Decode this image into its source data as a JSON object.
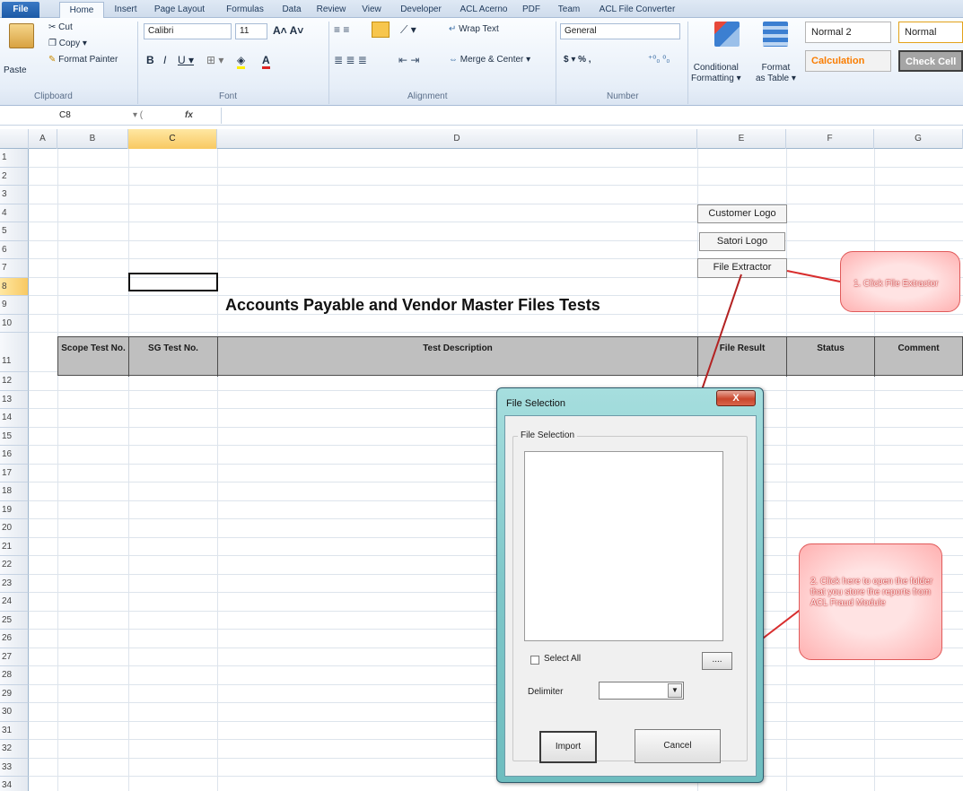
{
  "tabs": [
    "File",
    "Home",
    "Insert",
    "Page Layout",
    "Formulas",
    "Data",
    "Review",
    "View",
    "Developer",
    "ACL Acerno",
    "PDF",
    "Team",
    "ACL File Converter"
  ],
  "ribbon": {
    "clipboard": {
      "paste": "Paste",
      "cut": "Cut",
      "copy": "Copy ▾",
      "format_painter": "Format Painter",
      "label": "Clipboard"
    },
    "font": {
      "name": "Calibri",
      "size": "11",
      "label": "Font"
    },
    "alignment": {
      "wrap_text": "Wrap Text",
      "merge_center": "Merge & Center ▾",
      "label": "Alignment"
    },
    "number": {
      "format": "General",
      "currency": "$ ▾ % ,",
      "label": "Number"
    },
    "styles": {
      "conditional": "Conditional\nFormatting ▾",
      "format_table": "Format\nas Table ▾",
      "normal2": "Normal 2",
      "normal": "Normal",
      "calculation": "Calculation",
      "check_cell": "Check Cell"
    }
  },
  "formula_bar": {
    "name_box": "C8",
    "fx": "fx"
  },
  "columns": [
    "A",
    "B",
    "C",
    "D",
    "E",
    "F",
    "G"
  ],
  "rows": [
    "1",
    "2",
    "3",
    "4",
    "5",
    "6",
    "7",
    "8",
    "9",
    "10",
    "11",
    "12",
    "13",
    "14",
    "15",
    "16",
    "17",
    "18",
    "19",
    "20",
    "21",
    "22",
    "23",
    "24",
    "25",
    "26",
    "27",
    "28",
    "29",
    "30",
    "31",
    "32",
    "33",
    "34"
  ],
  "sheet": {
    "buttons": {
      "customer_logo": "Customer Logo",
      "satori_logo": "Satori Logo",
      "file_extractor": "File Extractor"
    },
    "title": "Accounts Payable and Vendor Master Files Tests",
    "table_headers": [
      "Scope Test No.",
      "SG Test No.",
      "Test Description",
      "File Result",
      "Status",
      "Comment"
    ]
  },
  "callouts": {
    "step1": "1. Click File Extractor",
    "step2": "2. Click here to open the folder that you store the  reports from ACL Fraud Module"
  },
  "dialog": {
    "title": "File Selection",
    "close": "X",
    "frame_label": "File Selection",
    "select_all": "Select All",
    "browse": "....",
    "delimiter_label": "Delimiter",
    "delimiter_value": "",
    "import": "Import",
    "cancel": "Cancel"
  },
  "colors": {
    "accent": "#1c5aa6",
    "selected_header": "#f8c962",
    "callout": "#e05a5a",
    "dialog_frame": "#7ec7c9",
    "arrow": "#c0292b"
  }
}
